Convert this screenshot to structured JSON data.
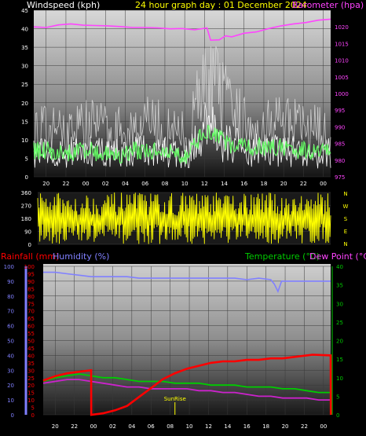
{
  "titles": {
    "windspeed": "Windspeed (kph)",
    "graph_day": "24 hour graph day : 01 December 2024",
    "barometer": "Barometer (hpa)",
    "rainfall": "Rainfall (mm)",
    "humidity": "Humidity (%)",
    "temperature": "Temperature (°C)",
    "dewpoint": "Dew Point (°C)",
    "sunrise": "SunRise"
  },
  "colors": {
    "windspeed": "#ffffff",
    "gust": "#d8d8d8",
    "avg_wind": "#66ff66",
    "barometer": "#ff44ff",
    "direction": "#ffff00",
    "rainfall": "#ff0000",
    "humidity": "#7f7fff",
    "temperature": "#00cc00",
    "dewpoint": "#cc22cc",
    "title_yellow": "#ffff00"
  },
  "chart_data": [
    {
      "type": "line",
      "name": "wind-barometer",
      "x_ticks": [
        "20",
        "22",
        "00",
        "02",
        "04",
        "06",
        "08",
        "10",
        "12",
        "14",
        "16",
        "18",
        "20",
        "22",
        "00"
      ],
      "left_axis": {
        "label": "Windspeed (kph)",
        "ylim": [
          0,
          45
        ],
        "ticks": [
          "0",
          "5",
          "10",
          "15",
          "20",
          "25",
          "30",
          "35",
          "40",
          "45"
        ]
      },
      "right_axis": {
        "label": "Barometer (hpa)",
        "ylim": [
          975,
          1025
        ],
        "ticks": [
          "975",
          "980",
          "985",
          "990",
          "995",
          "1000",
          "1005",
          "1010",
          "1015",
          "1020"
        ]
      },
      "gust_profile": [
        16,
        15,
        15,
        16,
        17,
        16,
        15,
        16,
        17,
        16,
        14,
        14,
        30,
        28,
        20,
        18,
        17,
        18,
        17,
        16,
        15,
        15
      ],
      "avg_profile": [
        7,
        7,
        6,
        7,
        7,
        6,
        6,
        7,
        7,
        7,
        6,
        6,
        12,
        11,
        8,
        8,
        8,
        8,
        8,
        7,
        7,
        7
      ],
      "barometer": [
        [
          0,
          1020.0
        ],
        [
          1,
          1019.8
        ],
        [
          2,
          1020.6
        ],
        [
          3,
          1020.9
        ],
        [
          4,
          1020.5
        ],
        [
          5,
          1020.4
        ],
        [
          6,
          1020.3
        ],
        [
          7,
          1020.1
        ],
        [
          8,
          1019.8
        ],
        [
          9,
          1019.8
        ],
        [
          10,
          1019.7
        ],
        [
          11,
          1019.4
        ],
        [
          12,
          1019.5
        ],
        [
          13,
          1019.1
        ],
        [
          14,
          1019.7
        ],
        [
          14.3,
          1016.0
        ],
        [
          15,
          1016.1
        ],
        [
          15.5,
          1017.3
        ],
        [
          16,
          1017.0
        ],
        [
          17,
          1018.1
        ],
        [
          18,
          1018.5
        ],
        [
          19,
          1019.5
        ],
        [
          20,
          1020.3
        ],
        [
          21,
          1020.9
        ],
        [
          22,
          1021.3
        ],
        [
          23,
          1022.0
        ],
        [
          24,
          1022.3
        ]
      ]
    },
    {
      "type": "line",
      "name": "wind-direction",
      "x_ticks": [
        "20",
        "22",
        "00",
        "02",
        "04",
        "06",
        "08",
        "10",
        "12",
        "14",
        "16",
        "18",
        "20",
        "22",
        "00"
      ],
      "y_axis": {
        "ylim": [
          0,
          360
        ],
        "ticks": [
          "0",
          "90",
          "180",
          "270",
          "360"
        ]
      },
      "compass_labels": [
        "N",
        "W",
        "S",
        "E",
        "N"
      ]
    },
    {
      "type": "line",
      "name": "rain-humidity-temperature",
      "x_ticks": [
        "20",
        "22",
        "00",
        "02",
        "04",
        "06",
        "08",
        "10",
        "12",
        "14",
        "16",
        "18",
        "20",
        "22",
        "00"
      ],
      "left_axis_humidity": {
        "label": "Humidity (%)",
        "ylim": [
          0,
          100
        ],
        "ticks": [
          "0",
          "10",
          "20",
          "30",
          "40",
          "50",
          "60",
          "70",
          "80",
          "90",
          "100"
        ]
      },
      "left_axis_rain": {
        "label": "Rainfall (mm)",
        "ylim": [
          0,
          100
        ],
        "ticks": [
          "0",
          "5",
          "10",
          "15",
          "20",
          "25",
          "30",
          "35",
          "40",
          "45",
          "50",
          "55",
          "60",
          "65",
          "70",
          "75",
          "80",
          "85",
          "90",
          "95",
          "100"
        ]
      },
      "right_axis": {
        "label": "Temperature (°C)",
        "ylim": [
          0,
          40
        ],
        "ticks": [
          "0",
          "5",
          "10",
          "15",
          "20",
          "25",
          "30",
          "35",
          "40"
        ]
      },
      "rainfall": [
        [
          0,
          23
        ],
        [
          1,
          26
        ],
        [
          2,
          28
        ],
        [
          3,
          29
        ],
        [
          4,
          30
        ],
        [
          4.01,
          0
        ],
        [
          5,
          1
        ],
        [
          6,
          3
        ],
        [
          7,
          6
        ],
        [
          8,
          12
        ],
        [
          9,
          18
        ],
        [
          10,
          24
        ],
        [
          11,
          28
        ],
        [
          12,
          31
        ],
        [
          13,
          33
        ],
        [
          14,
          35
        ],
        [
          15,
          36
        ],
        [
          16,
          36
        ],
        [
          17,
          37
        ],
        [
          18,
          37
        ],
        [
          19,
          38
        ],
        [
          20,
          38
        ],
        [
          21,
          39
        ],
        [
          22,
          40
        ],
        [
          22.5,
          40.5
        ],
        [
          24,
          40
        ],
        [
          24.01,
          0
        ]
      ],
      "humidity": [
        [
          0,
          96
        ],
        [
          1,
          96
        ],
        [
          2,
          95
        ],
        [
          3,
          94
        ],
        [
          4,
          93
        ],
        [
          5,
          93
        ],
        [
          6,
          93
        ],
        [
          7,
          93
        ],
        [
          8,
          92
        ],
        [
          9,
          92
        ],
        [
          10,
          92
        ],
        [
          11,
          92
        ],
        [
          12,
          92
        ],
        [
          13,
          92
        ],
        [
          14,
          92
        ],
        [
          15,
          92
        ],
        [
          16,
          92
        ],
        [
          17,
          91
        ],
        [
          18,
          92
        ],
        [
          19,
          91
        ],
        [
          19.3,
          88
        ],
        [
          19.6,
          83
        ],
        [
          19.9,
          90
        ],
        [
          20.5,
          90
        ],
        [
          21,
          90
        ],
        [
          22,
          90
        ],
        [
          23,
          90
        ],
        [
          24,
          90
        ]
      ],
      "temperature": [
        [
          0,
          9
        ],
        [
          1,
          10
        ],
        [
          2,
          10.5
        ],
        [
          3,
          11
        ],
        [
          4,
          10.5
        ],
        [
          5,
          10
        ],
        [
          6,
          10
        ],
        [
          7,
          9.5
        ],
        [
          8,
          9
        ],
        [
          9,
          9
        ],
        [
          10,
          9
        ],
        [
          11,
          8.5
        ],
        [
          12,
          8.5
        ],
        [
          13,
          8.5
        ],
        [
          14,
          8
        ],
        [
          15,
          8
        ],
        [
          16,
          8
        ],
        [
          17,
          7.5
        ],
        [
          18,
          7.5
        ],
        [
          19,
          7.5
        ],
        [
          20,
          7
        ],
        [
          21,
          7
        ],
        [
          22,
          6.5
        ],
        [
          23,
          6
        ],
        [
          24,
          6
        ]
      ],
      "dewpoint": [
        [
          0,
          8.5
        ],
        [
          1,
          9
        ],
        [
          2,
          9.5
        ],
        [
          3,
          9.5
        ],
        [
          4,
          9
        ],
        [
          5,
          8.5
        ],
        [
          6,
          8
        ],
        [
          7,
          7.5
        ],
        [
          8,
          7.5
        ],
        [
          9,
          7
        ],
        [
          10,
          7
        ],
        [
          11,
          7
        ],
        [
          12,
          7
        ],
        [
          13,
          6.5
        ],
        [
          14,
          6.5
        ],
        [
          15,
          6
        ],
        [
          16,
          6
        ],
        [
          17,
          5.5
        ],
        [
          18,
          5
        ],
        [
          19,
          5
        ],
        [
          20,
          4.5
        ],
        [
          21,
          4.5
        ],
        [
          22,
          4.5
        ],
        [
          23,
          4
        ],
        [
          24,
          4
        ]
      ],
      "sunrise_hour": 11.0
    }
  ]
}
